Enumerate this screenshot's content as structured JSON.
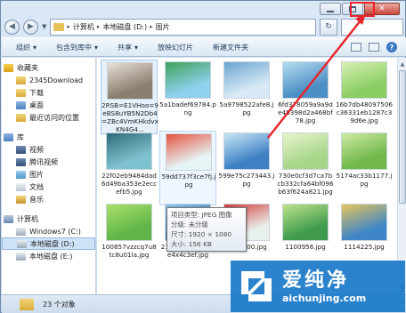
{
  "address": {
    "crumbs": [
      "计算机",
      "本地磁盘 (D:)",
      "图片"
    ]
  },
  "toolbar": {
    "organize": "组织",
    "include_in_library": "包含到库中",
    "share": "共享",
    "slideshow": "放映幻灯片",
    "new_folder": "新建文件夹"
  },
  "navpane": {
    "favorites_header": "收藏夹",
    "favorites": [
      "2345Download",
      "下载",
      "桌面",
      "最近访问的位置"
    ],
    "libraries_header": "库",
    "libraries": [
      "视频",
      "腾讯视频",
      "图片",
      "文档",
      "音乐"
    ],
    "computer_header": "计算机",
    "drives": [
      "Windows7 (C:)",
      "本地磁盘 (D:)",
      "本地磁盘 (E:)"
    ]
  },
  "files": [
    {
      "name": "2RSB=E1VHoo=9eBS8uYB5N2Db4=ZBc4VmKHkdvxKN4G4...",
      "color": "#8a7e6e",
      "accent": "#e7e0d6"
    },
    {
      "name": "5a1badef69784.png",
      "color": "#8fd0ef",
      "accent": "#3fa35a"
    },
    {
      "name": "5a9798522afe8.jpg",
      "color": "#d7eaf6",
      "accent": "#6aa4d0"
    },
    {
      "name": "6fd378059a9a9de49398d2a468bf78.jpg",
      "color": "#4c8fc4",
      "accent": "#b4dcf0"
    },
    {
      "name": "16b7db48097506c36331eb1287c39d6e.jpg",
      "color": "#8acd63",
      "accent": "#d8f0b4"
    },
    {
      "name": "22f02eb9484dad6d49ba353e2eccefb5.jpg",
      "color": "#7fc2cf",
      "accent": "#2c6c76"
    },
    {
      "name": "59dd737f3ce7fj.jpg",
      "color": "#e6f4f6",
      "accent": "#e55340"
    },
    {
      "name": "599e75c273443.jpg",
      "color": "#3e80c4",
      "accent": "#c9e7f6"
    },
    {
      "name": "730e0cf3d7ca7bcb332cfa64bf096b63f624a821.jpg",
      "color": "#a7d689",
      "accent": "#e8f4cc"
    },
    {
      "name": "5174ac33b1177.jpg",
      "color": "#70b84a",
      "accent": "#cfe9a4"
    },
    {
      "name": "100857vzzcq7u8tc8u01la.jpg",
      "color": "#5fb548",
      "accent": "#a9e06a"
    },
    {
      "name": "214451dse3lqq2e4x4c3ef.jpg",
      "color": "#3a6fb0",
      "accent": "#8cc4ea"
    },
    {
      "name": "1042600.jpg",
      "color": "#e9f1ec",
      "accent": "#d13a3a"
    },
    {
      "name": "1100956.jpg",
      "color": "#3f9a4c",
      "accent": "#bde38a"
    },
    {
      "name": "1114225.jpg",
      "color": "#3f86c8",
      "accent": "#e7c45a"
    }
  ],
  "tooltip": {
    "type": "项目类型: JPEG 图像",
    "rating": "分级: 未分级",
    "size": "尺寸: 1920 × 1080",
    "filesize": "大小: 156 KB"
  },
  "status": {
    "count": "23 个对象"
  },
  "watermark": {
    "cn": "爱纯净",
    "url": "aichunjing.com"
  }
}
